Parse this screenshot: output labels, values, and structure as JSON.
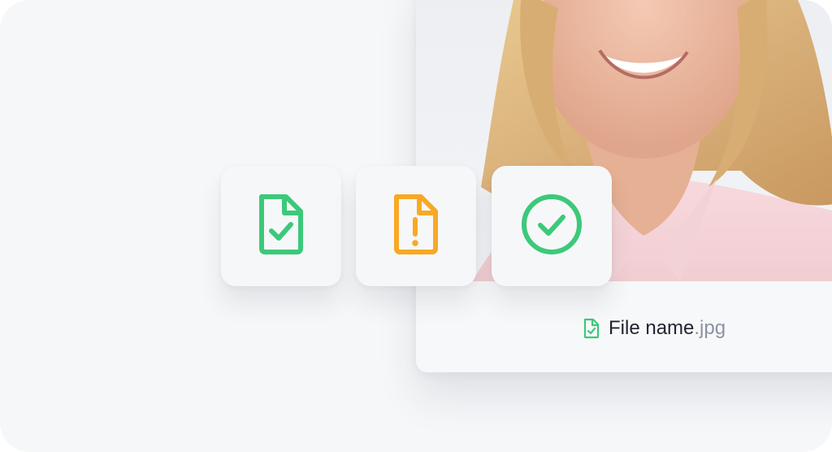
{
  "colors": {
    "success": "#3cc97a",
    "warning": "#f9a825",
    "background": "#f6f7f9",
    "text": "#1f2430",
    "muted": "#8a93a3"
  },
  "status_tiles": [
    {
      "icon": "file-check-icon",
      "status": "valid"
    },
    {
      "icon": "file-warning-icon",
      "status": "warning"
    },
    {
      "icon": "check-circle-icon",
      "status": "success"
    }
  ],
  "file": {
    "icon": "file-check-icon",
    "name": "File name",
    "extension": ".jpg"
  }
}
